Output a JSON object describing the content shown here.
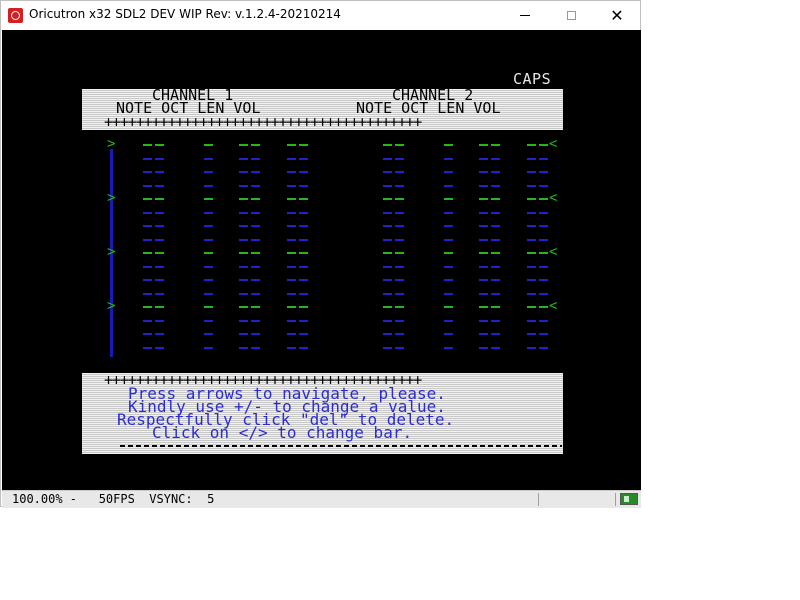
{
  "window": {
    "title": "Oricutron x32 SDL2 DEV WIP Rev: v.1.2.4-20210214",
    "minimize_label": "—",
    "maximize_label": "☐",
    "close_label": "✕"
  },
  "screen": {
    "caps": "CAPS",
    "header": {
      "channel1": "CHANNEL 1",
      "channel2": "CHANNEL 2",
      "columns1": "NOTE OCT LEN VOL",
      "columns2": "NOTE OCT LEN VOL",
      "plus_row": "++++++++++++++++++++++++++++++++++++++++"
    },
    "grid": {
      "row_count": 16,
      "marked_rows": [
        0,
        4,
        8,
        12
      ],
      "active_color": "#22b822",
      "inactive_color": "#2222c8",
      "bar_color": "#1a1ab8",
      "left_marker": ">",
      "right_marker": "<"
    },
    "help": {
      "plus_row": "++++++++++++++++++++++++++++++++++++++++",
      "line1": "Press arrows to navigate, please.",
      "line2": "Kindly use +/- to change a value.",
      "line3": "Respectfully click \"del\" to delete.",
      "line4": "Click on </> to change bar."
    }
  },
  "statusbar": {
    "text": "100.00% -   50FPS  VSYNC:  5"
  }
}
